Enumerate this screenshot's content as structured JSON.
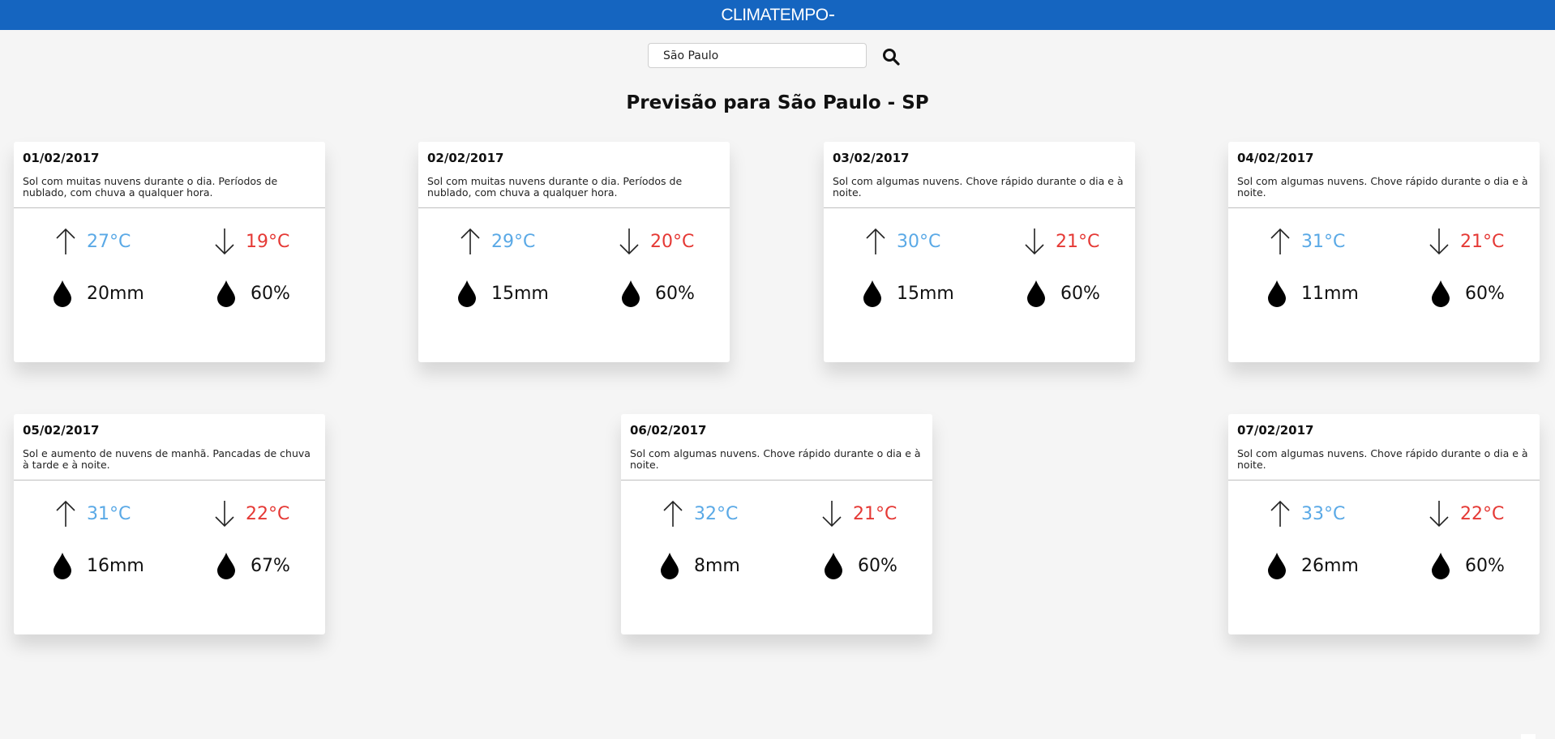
{
  "header": {
    "logo_text": "CLIMATEMPO",
    "bar_color": "#1565c0"
  },
  "search": {
    "value": "São Paulo",
    "placeholder": "",
    "icon": "search-icon"
  },
  "page": {
    "title": "Previsão para São Paulo - SP"
  },
  "colors": {
    "max_temp": "#5aa9e6",
    "min_temp": "#e53935"
  },
  "icons": {
    "max": "arrow-up-icon",
    "min": "arrow-down-icon",
    "rain": "drop-icon",
    "humidity": "drop-icon"
  },
  "forecast": [
    {
      "date": "01/02/2017",
      "description": "Sol com muitas nuvens durante o dia. Períodos de nublado, com chuva a qualquer hora.",
      "max": "27°C",
      "min": "19°C",
      "rain": "20mm",
      "humidity": "60%"
    },
    {
      "date": "02/02/2017",
      "description": "Sol com muitas nuvens durante o dia. Períodos de nublado, com chuva a qualquer hora.",
      "max": "29°C",
      "min": "20°C",
      "rain": "15mm",
      "humidity": "60%"
    },
    {
      "date": "03/02/2017",
      "description": "Sol com algumas nuvens. Chove rápido durante o dia e à noite.",
      "max": "30°C",
      "min": "21°C",
      "rain": "15mm",
      "humidity": "60%"
    },
    {
      "date": "04/02/2017",
      "description": "Sol com algumas nuvens. Chove rápido durante o dia e à noite.",
      "max": "31°C",
      "min": "21°C",
      "rain": "11mm",
      "humidity": "60%"
    },
    {
      "date": "05/02/2017",
      "description": "Sol e aumento de nuvens de manhã. Pancadas de chuva à tarde e à noite.",
      "max": "31°C",
      "min": "22°C",
      "rain": "16mm",
      "humidity": "67%"
    },
    {
      "date": "06/02/2017",
      "description": "Sol com algumas nuvens. Chove rápido durante o dia e à noite.",
      "max": "32°C",
      "min": "21°C",
      "rain": "8mm",
      "humidity": "60%"
    },
    {
      "date": "07/02/2017",
      "description": "Sol com algumas nuvens. Chove rápido durante o dia e à noite.",
      "max": "33°C",
      "min": "22°C",
      "rain": "26mm",
      "humidity": "60%"
    }
  ]
}
